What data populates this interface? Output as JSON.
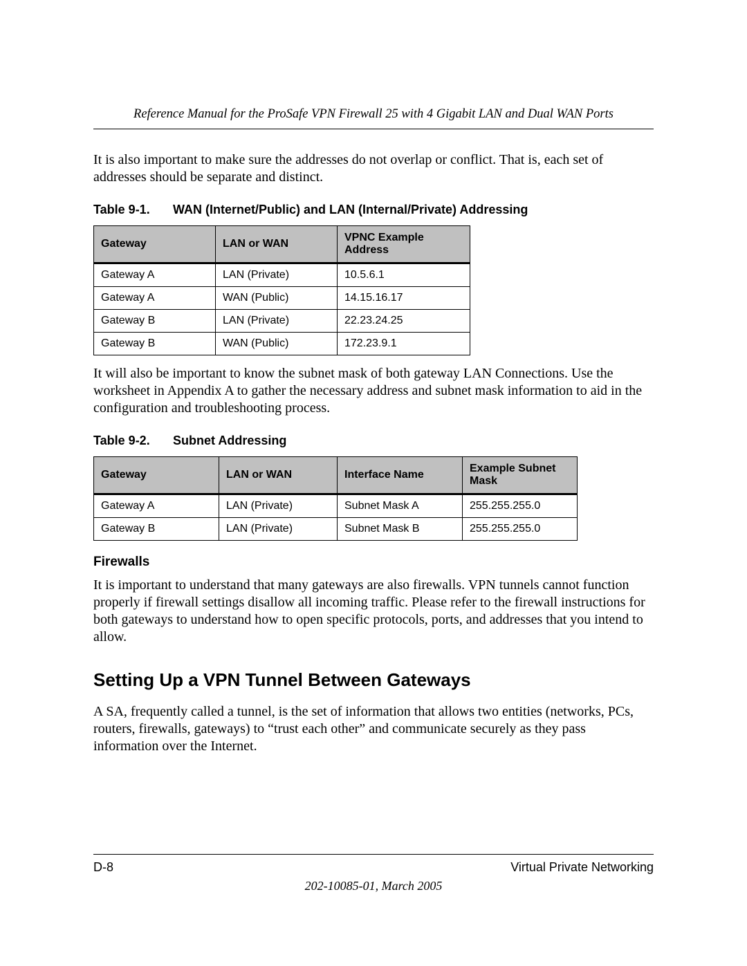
{
  "header": {
    "title": "Reference Manual for the ProSafe VPN Firewall 25 with 4 Gigabit LAN and Dual WAN Ports"
  },
  "p1": "It is also important to make sure the addresses do not overlap or conflict. That is, each set of addresses should be separate and distinct.",
  "table1": {
    "caption_num": "Table 9-1.",
    "caption_title": "WAN (Internet/Public) and LAN (Internal/Private) Addressing",
    "headers": [
      "Gateway",
      "LAN or WAN",
      "VPNC Example Address"
    ],
    "rows": [
      [
        "Gateway A",
        "LAN (Private)",
        "10.5.6.1"
      ],
      [
        "Gateway A",
        "WAN (Public)",
        "14.15.16.17"
      ],
      [
        "Gateway B",
        "LAN (Private)",
        "22.23.24.25"
      ],
      [
        "Gateway B",
        "WAN (Public)",
        "172.23.9.1"
      ]
    ]
  },
  "p2": "It will also be important to know the subnet mask of both gateway LAN Connections. Use the worksheet in Appendix A to gather the necessary address and subnet mask information to aid in the configuration and troubleshooting process.",
  "table2": {
    "caption_num": "Table 9-2.",
    "caption_title": "Subnet Addressing",
    "headers": [
      "Gateway",
      "LAN or WAN",
      "Interface Name",
      "Example Subnet Mask"
    ],
    "rows": [
      [
        "Gateway A",
        "LAN (Private)",
        "Subnet Mask A",
        "255.255.255.0"
      ],
      [
        "Gateway B",
        "LAN (Private)",
        "Subnet Mask B",
        "255.255.255.0"
      ]
    ]
  },
  "firewalls_heading": "Firewalls",
  "p3": "It is important to understand that many gateways are also firewalls. VPN tunnels cannot function properly if firewall settings disallow all incoming traffic. Please refer to the firewall instructions for both gateways to understand how to open specific protocols, ports, and addresses that you intend to allow.",
  "section_heading": "Setting Up a VPN Tunnel Between Gateways",
  "p4": "A SA, frequently called a tunnel, is the set of information that allows two entities (networks, PCs, routers, firewalls, gateways) to “trust each other” and communicate securely as they pass information over the Internet.",
  "footer": {
    "page": "D-8",
    "section": "Virtual Private Networking",
    "docid": "202-10085-01, March 2005"
  }
}
